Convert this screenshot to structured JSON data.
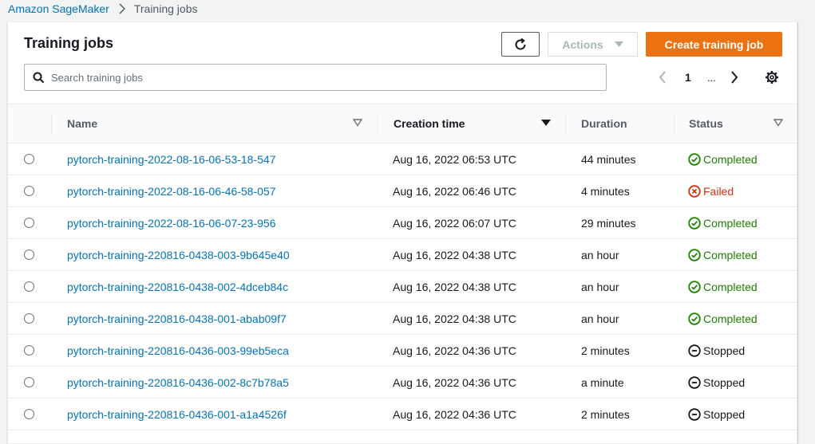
{
  "breadcrumb": {
    "root": "Amazon SageMaker",
    "current": "Training jobs"
  },
  "header": {
    "title": "Training jobs",
    "refresh_icon": "refresh-icon",
    "actions_label": "Actions",
    "create_label": "Create training job"
  },
  "search": {
    "placeholder": "Search training jobs",
    "value": ""
  },
  "pagination": {
    "current_page": "1",
    "ellipsis": "..."
  },
  "columns": {
    "name": "Name",
    "creation_time": "Creation time",
    "duration": "Duration",
    "status": "Status"
  },
  "rows": [
    {
      "name": "pytorch-training-2022-08-16-06-53-18-547",
      "creation_time": "Aug 16, 2022 06:53 UTC",
      "duration": "44 minutes",
      "status": "Completed"
    },
    {
      "name": "pytorch-training-2022-08-16-06-46-58-057",
      "creation_time": "Aug 16, 2022 06:46 UTC",
      "duration": "4 minutes",
      "status": "Failed"
    },
    {
      "name": "pytorch-training-2022-08-16-06-07-23-956",
      "creation_time": "Aug 16, 2022 06:07 UTC",
      "duration": "29 minutes",
      "status": "Completed"
    },
    {
      "name": "pytorch-training-220816-0438-003-9b645e40",
      "creation_time": "Aug 16, 2022 04:38 UTC",
      "duration": "an hour",
      "status": "Completed"
    },
    {
      "name": "pytorch-training-220816-0438-002-4dceb84c",
      "creation_time": "Aug 16, 2022 04:38 UTC",
      "duration": "an hour",
      "status": "Completed"
    },
    {
      "name": "pytorch-training-220816-0438-001-abab09f7",
      "creation_time": "Aug 16, 2022 04:38 UTC",
      "duration": "an hour",
      "status": "Completed"
    },
    {
      "name": "pytorch-training-220816-0436-003-99eb5eca",
      "creation_time": "Aug 16, 2022 04:36 UTC",
      "duration": "2 minutes",
      "status": "Stopped"
    },
    {
      "name": "pytorch-training-220816-0436-002-8c7b78a5",
      "creation_time": "Aug 16, 2022 04:36 UTC",
      "duration": "a minute",
      "status": "Stopped"
    },
    {
      "name": "pytorch-training-220816-0436-001-a1a4526f",
      "creation_time": "Aug 16, 2022 04:36 UTC",
      "duration": "2 minutes",
      "status": "Stopped"
    }
  ],
  "colors": {
    "link": "#0073bb",
    "primary_button": "#ec7211",
    "completed": "#1d8102",
    "failed": "#d13212"
  }
}
